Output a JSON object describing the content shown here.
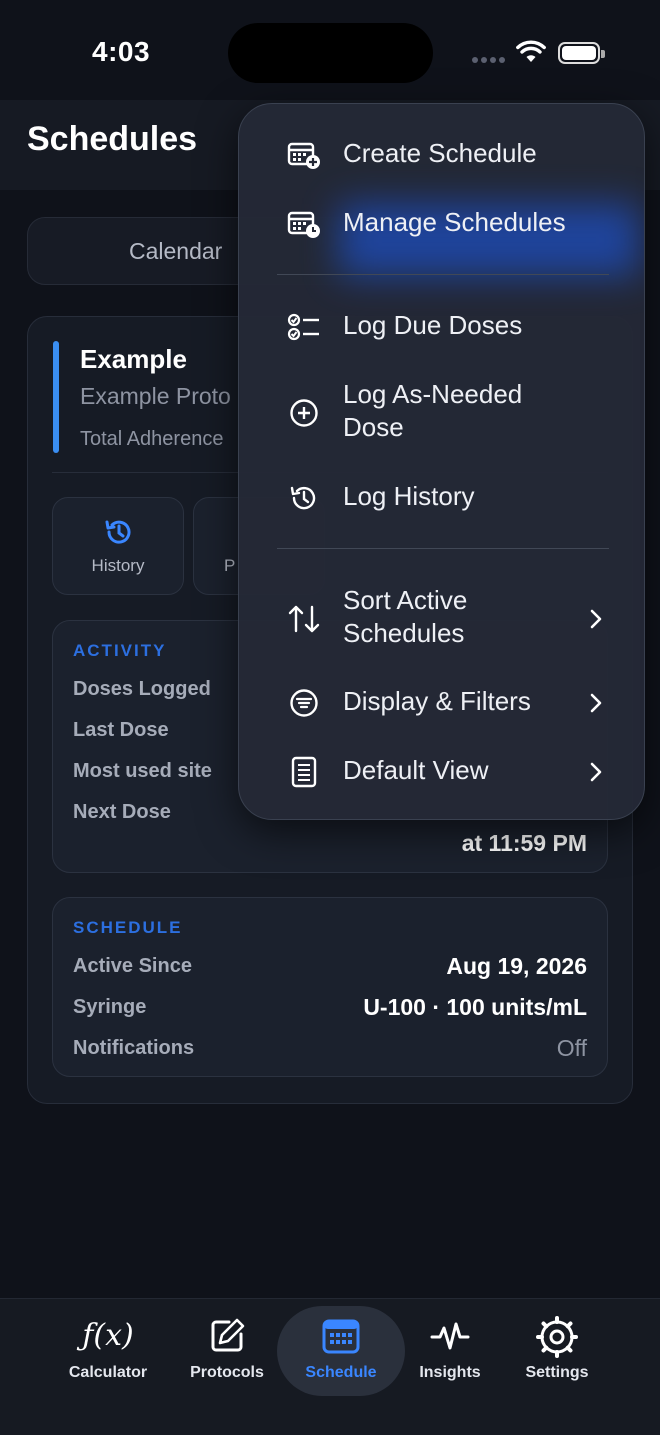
{
  "status": {
    "time": "4:03"
  },
  "header": {
    "title": "Schedules"
  },
  "segment": {
    "left_label": "Calendar"
  },
  "schedule_card": {
    "title": "Example",
    "protocol": "Example Proto",
    "adherence_label": "Total Adherence",
    "actions": [
      {
        "label": "History",
        "icon": "history-icon"
      },
      {
        "label": "P",
        "icon": "protocol-icon"
      }
    ],
    "activity": {
      "heading": "ACTIVITY",
      "rows": [
        {
          "label": "Doses Logged"
        },
        {
          "label": "Last Dose"
        },
        {
          "label": "Most used site"
        },
        {
          "label": "Next Dose",
          "value": "at 11:59 PM"
        }
      ]
    },
    "schedule": {
      "heading": "SCHEDULE",
      "rows": [
        {
          "label": "Active Since",
          "value": "Aug 19, 2026"
        },
        {
          "label": "Syringe",
          "value": "U-100 · 100 units/mL"
        },
        {
          "label": "Notifications",
          "value": "Off"
        }
      ]
    }
  },
  "menu": {
    "items": [
      {
        "label": "Create Schedule",
        "icon": "calendar-add-icon"
      },
      {
        "label": "Manage Schedules",
        "icon": "calendar-clock-icon"
      },
      {
        "label": "Log Due Doses",
        "icon": "checklist-icon"
      },
      {
        "label": "Log As-Needed",
        "label2": "Dose",
        "icon": "plus-circle-icon"
      },
      {
        "label": "Log History",
        "icon": "history-icon"
      },
      {
        "label": "Sort Active",
        "label2": "Schedules",
        "icon": "sort-arrows-icon"
      },
      {
        "label": "Display & Filters",
        "icon": "filter-icon"
      },
      {
        "label": "Default View",
        "icon": "document-icon"
      }
    ]
  },
  "tabs": [
    {
      "label": "Calculator",
      "icon": "function-icon"
    },
    {
      "label": "Protocols",
      "icon": "edit-square-icon"
    },
    {
      "label": "Schedule",
      "icon": "calendar-icon",
      "active": true
    },
    {
      "label": "Insights",
      "icon": "pulse-icon"
    },
    {
      "label": "Settings",
      "icon": "gear-icon"
    }
  ],
  "colors": {
    "accent": "#3a86ff",
    "section_heading": "#2c6fe0",
    "background": "#0f121a"
  }
}
